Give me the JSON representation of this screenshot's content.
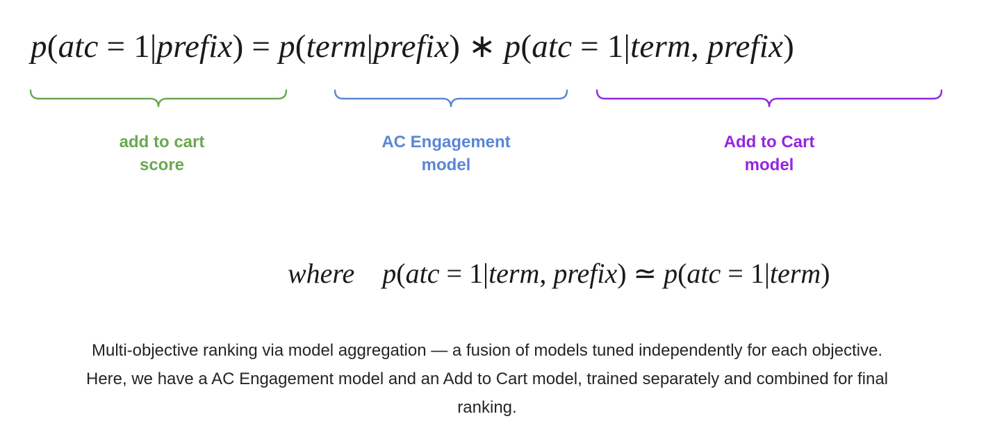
{
  "equation": {
    "main": "p(atc = 1|prefix) = p(term|prefix) ∗ p(atc = 1|term, prefix)",
    "where": "where    p(atc = 1|term, prefix) ≃ p(atc = 1|term)"
  },
  "braces": [
    {
      "line1": "add to cart",
      "line2": "score",
      "color": "#6aa84f"
    },
    {
      "line1": "AC Engagement",
      "line2": "model",
      "color": "#5b86d6"
    },
    {
      "line1": "Add to Cart",
      "line2": "model",
      "color": "#9425e0"
    }
  ],
  "caption": {
    "line1": "Multi-objective ranking via model aggregation — a fusion of models tuned independently for each objective.",
    "line2": "Here, we have a AC Engagement model and an Add to Cart model, trained separately and combined for final",
    "line3": "ranking."
  }
}
